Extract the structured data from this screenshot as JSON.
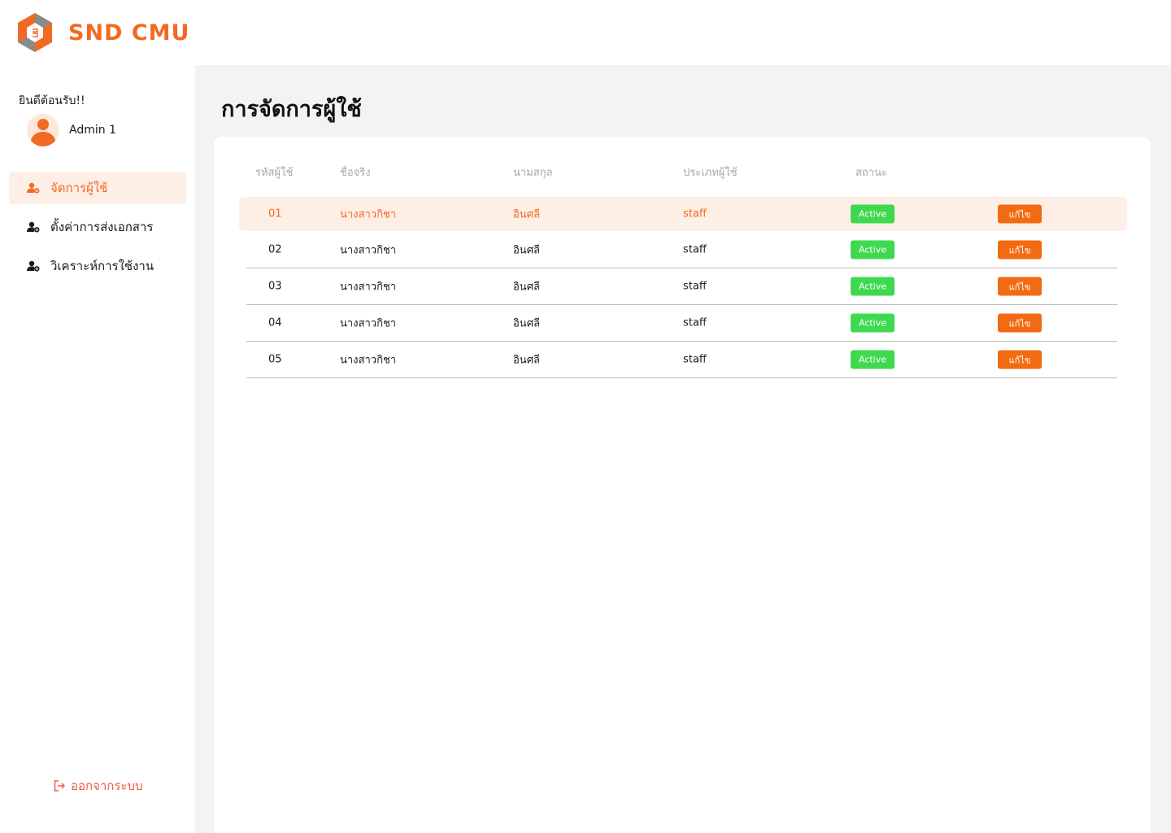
{
  "brand": {
    "name": "SND CMU",
    "accent": "#f26a21"
  },
  "sidebar": {
    "welcome": "ยินดีต้อนรับ!!",
    "user": {
      "name": "Admin 1"
    },
    "items": [
      {
        "label": "จัดการผู้ใช้",
        "icon": "user-gear-icon",
        "active": true
      },
      {
        "label": "ตั้งค่าการส่งเอกสาร",
        "icon": "user-gear-icon",
        "active": false
      },
      {
        "label": "วิเคราะห์การใช้งาน",
        "icon": "user-gear-icon",
        "active": false
      }
    ],
    "logout": "ออกจากระบบ"
  },
  "main": {
    "title": "การจัดการผู้ใช้",
    "table": {
      "columns": [
        "รหัสผู้ใช้",
        "ชื่อจริง",
        "นามสกุล",
        "ประเภทผู้ใช้",
        "สถานะ"
      ],
      "rows": [
        {
          "id": "01",
          "first": "นางสาวกิชา",
          "last": "อินศลี",
          "type": "staff",
          "status": "Active",
          "action": "แก้ไข",
          "selected": true
        },
        {
          "id": "02",
          "first": "นางสาวกิชา",
          "last": "อินศลี",
          "type": "staff",
          "status": "Active",
          "action": "แก้ไข",
          "selected": false
        },
        {
          "id": "03",
          "first": "นางสาวกิชา",
          "last": "อินศลี",
          "type": "staff",
          "status": "Active",
          "action": "แก้ไข",
          "selected": false
        },
        {
          "id": "04",
          "first": "นางสาวกิชา",
          "last": "อินศลี",
          "type": "staff",
          "status": "Active",
          "action": "แก้ไข",
          "selected": false
        },
        {
          "id": "05",
          "first": "นางสาวกิชา",
          "last": "อินศลี",
          "type": "staff",
          "status": "Active",
          "action": "แก้ไข",
          "selected": false
        }
      ]
    }
  },
  "colors": {
    "status_active": "#3fd94f",
    "edit_button": "#f26a12",
    "logout": "#ef5b4a",
    "row_highlight": "#fdeee6"
  }
}
